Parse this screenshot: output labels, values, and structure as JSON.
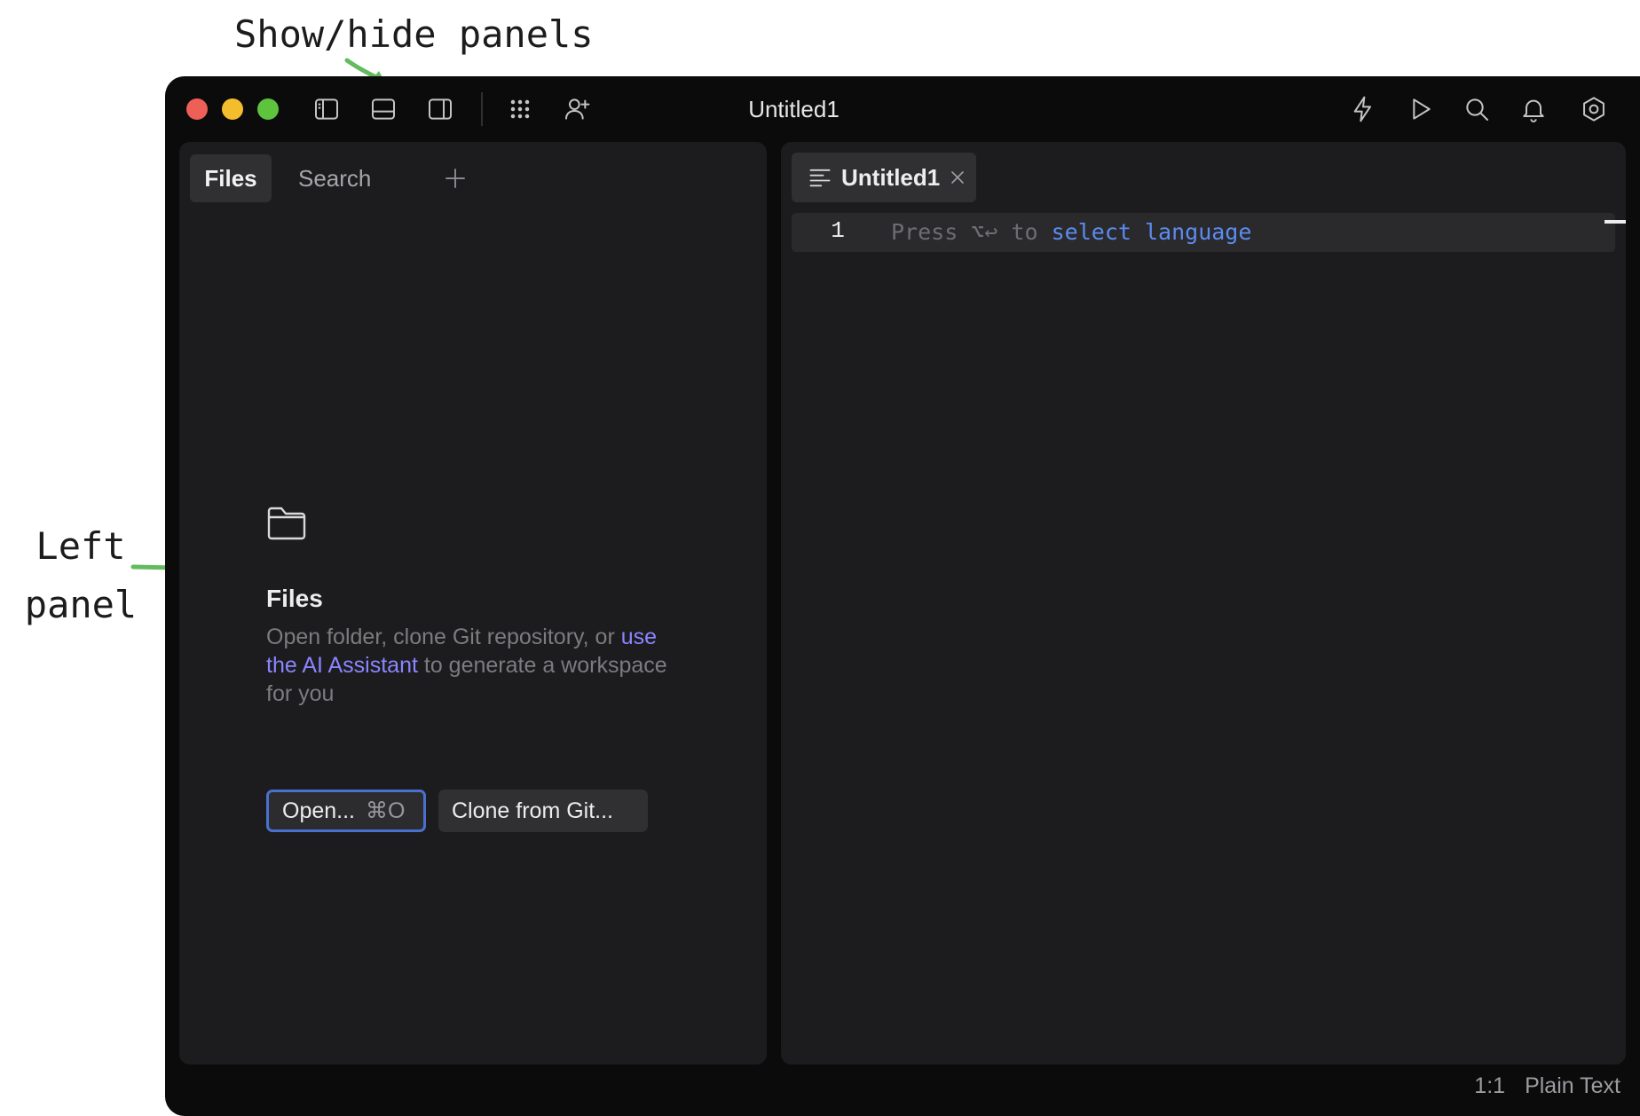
{
  "annotations": {
    "top": "Show/hide panels",
    "left_line1": "Left",
    "left_line2": "panel",
    "arrow_color": "#63bb5e"
  },
  "window": {
    "title": "Untitled1",
    "traffic_lights": [
      "close",
      "minimize",
      "zoom"
    ],
    "toolbar_left_icons": [
      "left-panel-toggle-icon",
      "bottom-panel-toggle-icon",
      "right-panel-toggle-icon",
      "apps-grid-icon",
      "add-user-icon"
    ],
    "toolbar_right_icons": [
      "lightning-icon",
      "run-icon",
      "search-icon",
      "bell-icon",
      "settings-icon"
    ]
  },
  "left_panel": {
    "tabs": [
      {
        "label": "Files",
        "active": true
      },
      {
        "label": "Search",
        "active": false
      }
    ],
    "empty_state": {
      "icon": "folder-icon",
      "heading": "Files",
      "desc_part1": "Open folder, clone Git repository, or ",
      "link": "use the AI Assistant",
      "desc_part2": " to generate a workspace for you",
      "open_label": "Open...",
      "open_shortcut": "⌘O",
      "clone_label": "Clone from Git..."
    }
  },
  "editor": {
    "tab_label": "Untitled1",
    "line_number": "1",
    "placeholder_prefix": "Press ⌥↩ to ",
    "placeholder_action": "select language"
  },
  "status": {
    "position": "1:1",
    "language": "Plain Text"
  },
  "colors": {
    "window_bg": "#0b0b0c",
    "panel_bg": "#1c1c1e",
    "accent_link": "#8a85ff",
    "focus_border": "#4a70cf",
    "keyword_blue": "#5c8cf0"
  }
}
